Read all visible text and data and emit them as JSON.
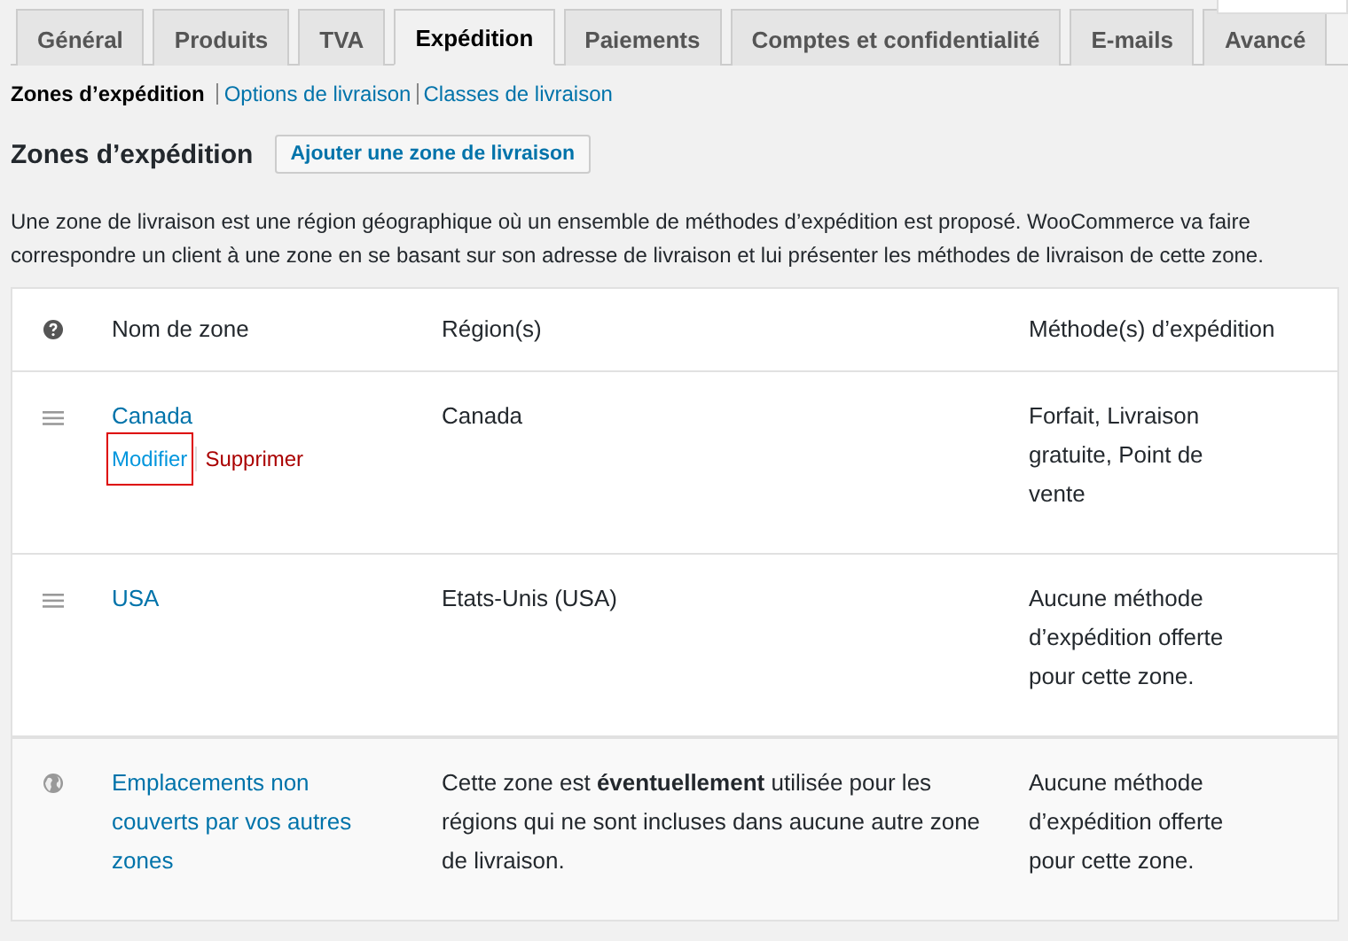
{
  "tabs": [
    {
      "label": "Général",
      "selected": false
    },
    {
      "label": "Produits",
      "selected": false
    },
    {
      "label": "TVA",
      "selected": false
    },
    {
      "label": "Expédition",
      "selected": true
    },
    {
      "label": "Paiements",
      "selected": false
    },
    {
      "label": "Comptes et confidentialité",
      "selected": false
    },
    {
      "label": "E-mails",
      "selected": false
    },
    {
      "label": "Avancé",
      "selected": false
    }
  ],
  "subnav": [
    {
      "label": "Zones d’expédition",
      "selected": true
    },
    {
      "label": "Options de livraison",
      "selected": false
    },
    {
      "label": "Classes de livraison",
      "selected": false
    }
  ],
  "heading": "Zones d’expédition",
  "add_button": "Ajouter une zone de livraison",
  "description": "Une zone de livraison est une région géographique où un ensemble de méthodes d’expédition est proposé. WooCommerce va faire correspondre un client à une zone en se basant sur son adresse de livraison et lui présenter les méthodes de livraison de cette zone.",
  "table": {
    "columns": [
      "Nom de zone",
      "Région(s)",
      "Méthode(s) d’expédition"
    ],
    "rows": [
      {
        "kind": "zone",
        "name": "Canada",
        "region": "Canada",
        "methods": "Forfait, Livraison gratuite, Point de vente",
        "actions": [
          {
            "label": "Modifier",
            "kind": "edit",
            "highlighted": true
          },
          {
            "label": "Supprimer",
            "kind": "delete",
            "highlighted": false
          }
        ]
      },
      {
        "kind": "zone",
        "name": "USA",
        "region": "Etats-Unis (USA)",
        "methods": "Aucune méthode d’expédition offerte pour cette zone."
      },
      {
        "kind": "fallback",
        "name": "Emplacements non couverts par vos autres zones",
        "region": "Cette zone est **éventuellement** utilisée pour les régions qui ne sont incluses dans aucune autre zone de livraison.",
        "methods": "Aucune méthode d’expédition offerte pour cette zone."
      }
    ]
  }
}
